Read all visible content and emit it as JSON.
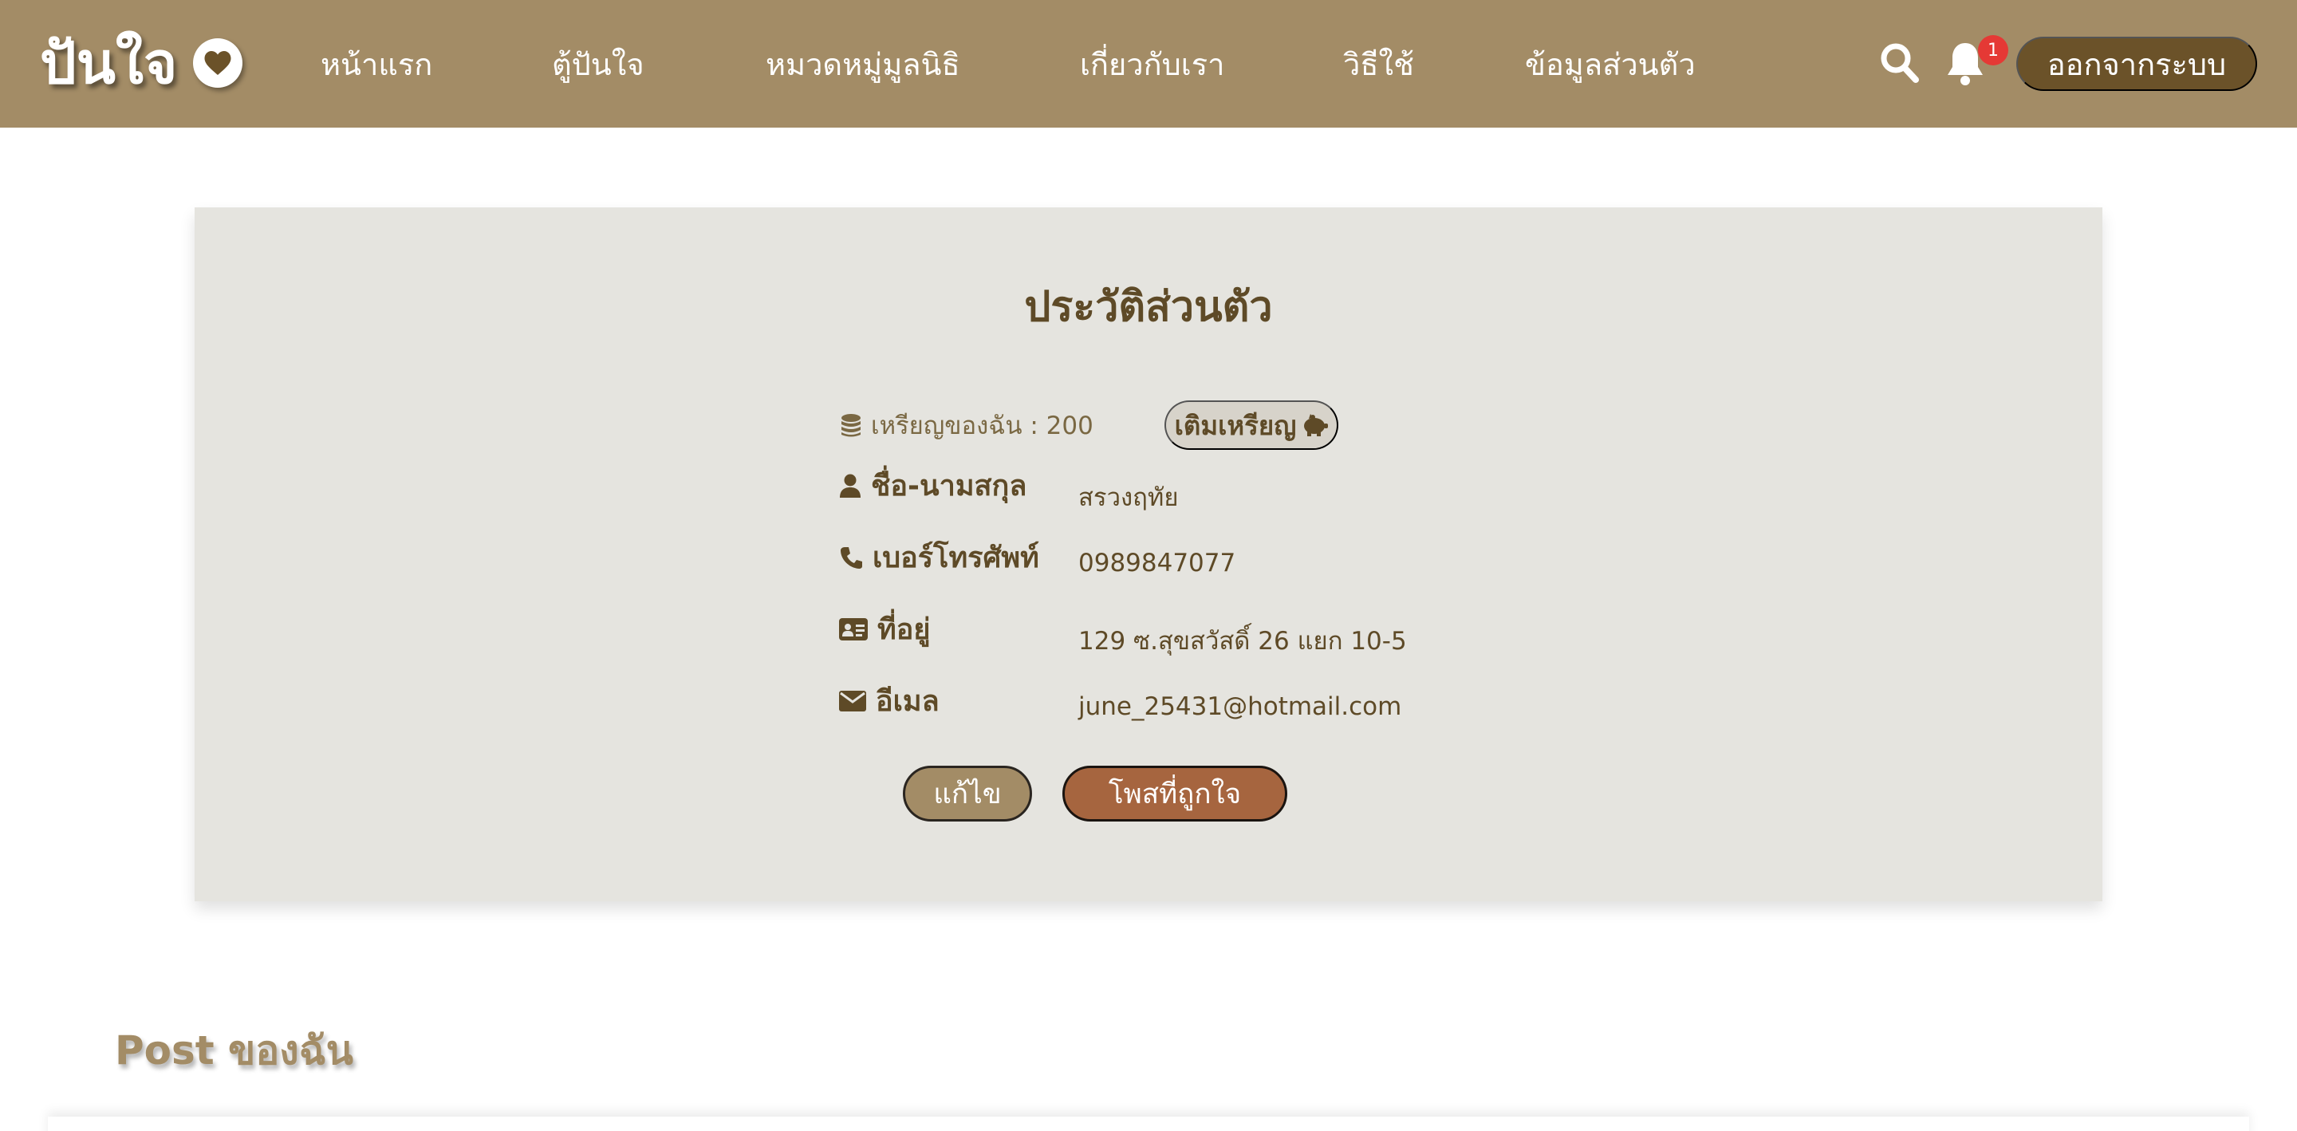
{
  "header": {
    "logo_text": "ปันใจ",
    "nav": {
      "home": "หน้าแรก",
      "box": "ตู้ปันใจ",
      "categories": "หมวดหมู่มูลนิธิ",
      "about": "เกี่ยวกับเรา",
      "how_to": "วิธีใช้",
      "profile": "ข้อมูลส่วนตัว"
    },
    "notification_count": "1",
    "logout_label": "ออกจากระบบ"
  },
  "profile": {
    "title": "ประวัติส่วนตัว",
    "coins_text": "เหรียญของฉัน : 200",
    "topup_label": "เติมเหรียญ",
    "fields": {
      "name": {
        "label": "ชื่อ-นามสกุล",
        "value": "สรวงฤทัย"
      },
      "phone": {
        "label": "เบอร์โทรศัพท์",
        "value": "0989847077"
      },
      "address": {
        "label": "ที่อยู่",
        "value": "129 ซ.สุขสวัสดิ์ 26 แยก 10-5"
      },
      "email": {
        "label": "อีเมล",
        "value": "june_25431@hotmail.com"
      }
    },
    "edit_label": "แก้ไข",
    "liked_posts_label": "โพสที่ถูกใจ"
  },
  "posts": {
    "title": "Post ของฉัน"
  },
  "colors": {
    "header_bg": "#a38c66",
    "brand_dark": "#6b5229",
    "text_brown": "#5e4a27",
    "card_bg": "#e5e4df",
    "liked_button": "#a6653f",
    "badge": "#e53935"
  },
  "icons": [
    "heart-icon",
    "search-icon",
    "bell-icon",
    "coins-icon",
    "piggy-bank-icon",
    "user-icon",
    "phone-icon",
    "id-card-icon",
    "envelope-icon"
  ]
}
